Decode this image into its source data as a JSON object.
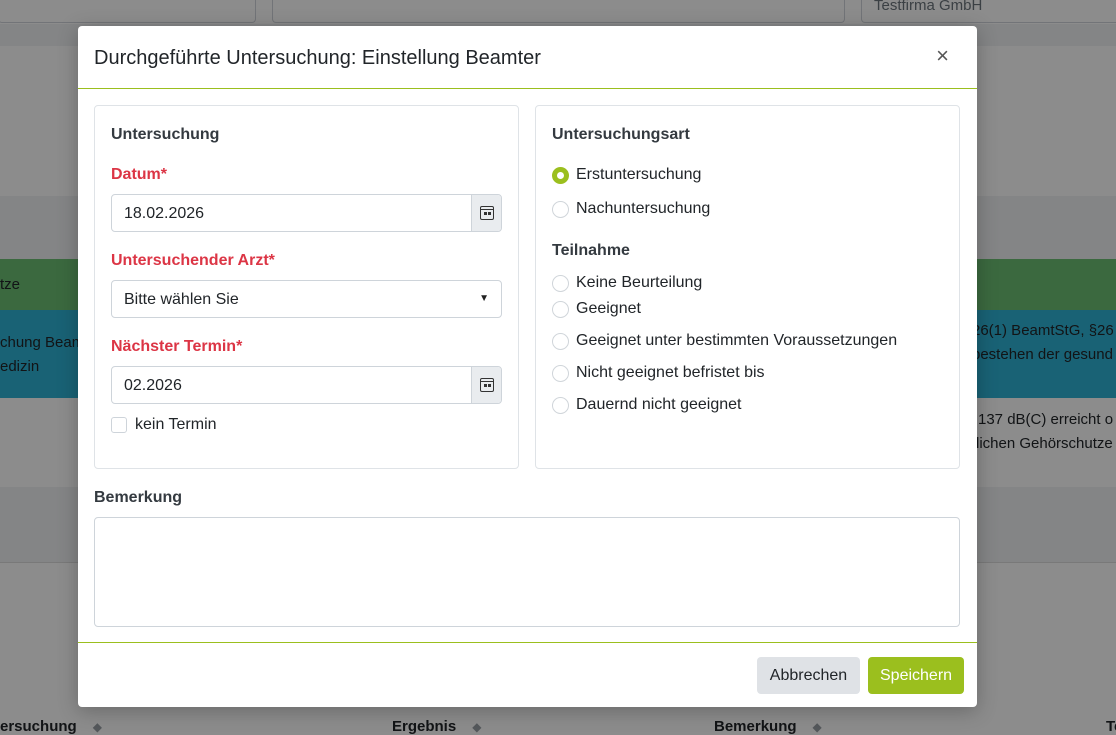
{
  "background": {
    "company": "Testfirma GmbH",
    "row_green_text": "tze",
    "row_blue_left_1": "chung Beam",
    "row_blue_left_2": "edizin",
    "row_blue_right_1": "26(1) BeamtStG, §26",
    "row_blue_right_2": "bestehen der gesund",
    "row_white_right_1": "137 dB(C) erreicht o",
    "row_white_right_2": "lichen Gehörschutze",
    "table_headers": [
      "ersuchung",
      "Ergebnis",
      "Bemerkung",
      "Te"
    ],
    "colors": {
      "green_row": "#6cbf73",
      "blue_row": "#2fb3d6"
    }
  },
  "modal": {
    "title": "Durchgeführte Untersuchung: Einstellung Beamter",
    "close_label": "×",
    "accent_color": "#9bbf1e",
    "untersuchung": {
      "title": "Untersuchung",
      "datum_label": "Datum*",
      "datum_value": "18.02.2026",
      "arzt_label": "Untersuchender Arzt*",
      "arzt_value": "Bitte wählen Sie",
      "naechster_label": "Nächster Termin*",
      "naechster_value": "02.2026",
      "kein_termin_label": "kein Termin",
      "kein_termin_checked": false
    },
    "untersuchungsart": {
      "title": "Untersuchungsart",
      "options": [
        {
          "label": "Erstuntersuchung",
          "checked": true
        },
        {
          "label": "Nachuntersuchung",
          "checked": false
        }
      ]
    },
    "teilnahme": {
      "title": "Teilnahme",
      "options": [
        {
          "label": "Keine Beurteilung",
          "checked": false
        },
        {
          "label": "Geeignet",
          "checked": false
        },
        {
          "label": "Geeignet unter bestimmten Voraussetzungen",
          "checked": false
        },
        {
          "label": "Nicht geeignet befristet bis",
          "checked": false
        },
        {
          "label": "Dauernd nicht geeignet",
          "checked": false
        }
      ]
    },
    "bemerkung": {
      "label": "Bemerkung",
      "value": ""
    },
    "footer": {
      "cancel_label": "Abbrechen",
      "save_label": "Speichern"
    }
  }
}
